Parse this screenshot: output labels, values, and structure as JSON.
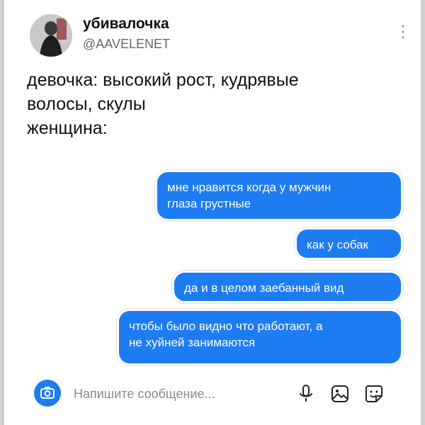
{
  "tweet": {
    "display_name": "убивалочка",
    "handle": "@AAVELENET",
    "text_lines": [
      "девочка: высокий рост, кудрявые",
      "волосы, скулы",
      "женщина:"
    ]
  },
  "messages": [
    {
      "lines": [
        "мне нравится когда у мужчин",
        "глаза грустные"
      ]
    },
    {
      "lines": [
        "как у собак"
      ]
    },
    {
      "lines": [
        "да и в целом заебанный вид"
      ]
    },
    {
      "lines": [
        "чтобы было видно что работают, а",
        "не хуйней занимаются"
      ]
    }
  ],
  "composer": {
    "placeholder": "Напишите сообщение...",
    "icons": [
      "camera-icon",
      "microphone-icon",
      "image-icon",
      "sticker-icon"
    ]
  },
  "colors": {
    "bubble": "#1e7cf2",
    "bubble_text": "#ffffff",
    "accent": "#1e7cf2"
  }
}
